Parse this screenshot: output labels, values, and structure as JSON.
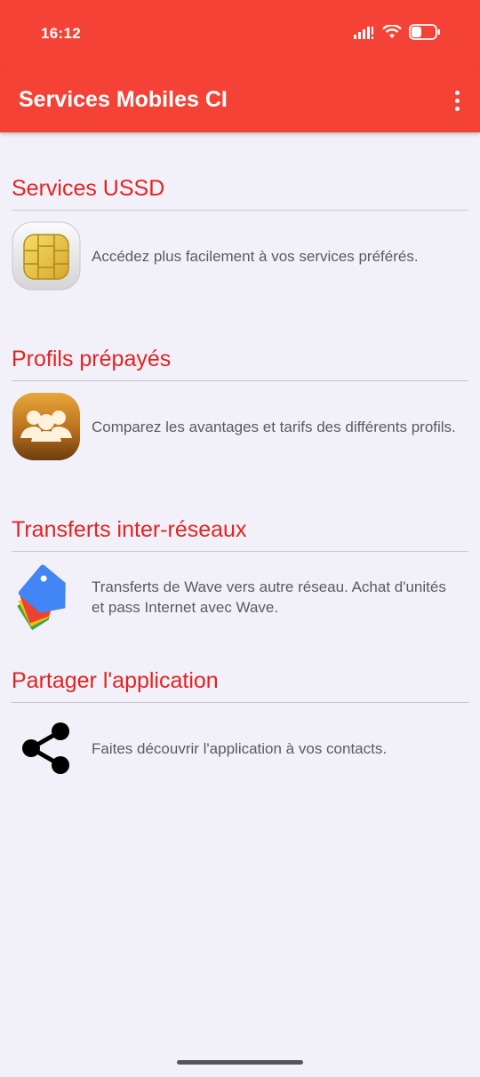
{
  "status_bar": {
    "time": "16:12",
    "icons": [
      "signal-icon",
      "wifi-icon",
      "battery-icon"
    ]
  },
  "app_bar": {
    "title": "Services Mobiles CI",
    "menu_icon": "more-vert-icon"
  },
  "sections": [
    {
      "title": "Services USSD",
      "icon": "sim-chip-icon",
      "description": "Accédez plus facilement à vos services préférés."
    },
    {
      "title": "Profils prépayés",
      "icon": "people-group-icon",
      "description": "Comparez les avantages et tarifs des différents profils."
    },
    {
      "title": "Transferts inter-réseaux",
      "icon": "price-tags-icon",
      "description": "Transferts de Wave vers autre réseau. Achat d'unités et pass Internet avec Wave."
    },
    {
      "title": "Partager l'application",
      "icon": "share-icon",
      "description": "Faites découvrir l'application à vos contacts."
    }
  ],
  "colors": {
    "primary": "#f44336",
    "section_title": "#e4231f",
    "background": "#f2f1fa",
    "text": "#5b5b5b"
  }
}
